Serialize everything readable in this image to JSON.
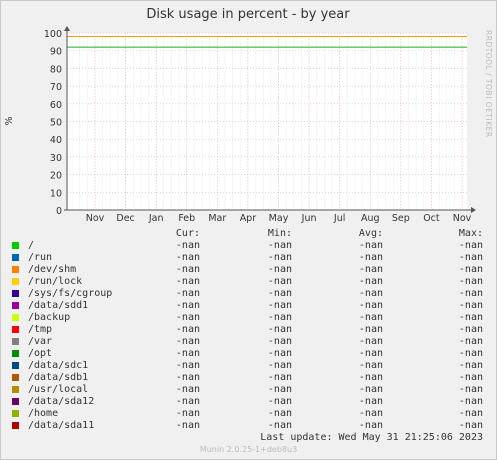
{
  "chart_data": {
    "type": "line",
    "title": "Disk usage in percent - by year",
    "ylabel": "%",
    "watermark": "RRDTOOL / TOBI OETIKER",
    "ylim": [
      0,
      100
    ],
    "yticks": [
      0,
      10,
      20,
      30,
      40,
      50,
      60,
      70,
      80,
      90,
      100
    ],
    "x_tick_labels": [
      "Nov",
      "Dec",
      "Jan",
      "Feb",
      "Mar",
      "Apr",
      "May",
      "Jun",
      "Jul",
      "Aug",
      "Sep",
      "Oct",
      "Nov"
    ],
    "grid": true,
    "threshold_lines": [
      {
        "value": 92,
        "color": "#22aa22"
      },
      {
        "value": 98,
        "color": "#ff9900"
      }
    ],
    "legend_headers": [
      "Cur:",
      "Min:",
      "Avg:",
      "Max:"
    ],
    "series": [
      {
        "name": "/",
        "color": "#00cc00",
        "cur": "-nan",
        "min": "-nan",
        "avg": "-nan",
        "max": "-nan"
      },
      {
        "name": "/run",
        "color": "#0066b3",
        "cur": "-nan",
        "min": "-nan",
        "avg": "-nan",
        "max": "-nan"
      },
      {
        "name": "/dev/shm",
        "color": "#ff8000",
        "cur": "-nan",
        "min": "-nan",
        "avg": "-nan",
        "max": "-nan"
      },
      {
        "name": "/run/lock",
        "color": "#ffcc00",
        "cur": "-nan",
        "min": "-nan",
        "avg": "-nan",
        "max": "-nan"
      },
      {
        "name": "/sys/fs/cgroup",
        "color": "#330099",
        "cur": "-nan",
        "min": "-nan",
        "avg": "-nan",
        "max": "-nan"
      },
      {
        "name": "/data/sdd1",
        "color": "#990099",
        "cur": "-nan",
        "min": "-nan",
        "avg": "-nan",
        "max": "-nan"
      },
      {
        "name": "/backup",
        "color": "#ccff00",
        "cur": "-nan",
        "min": "-nan",
        "avg": "-nan",
        "max": "-nan"
      },
      {
        "name": "/tmp",
        "color": "#ff0000",
        "cur": "-nan",
        "min": "-nan",
        "avg": "-nan",
        "max": "-nan"
      },
      {
        "name": "/var",
        "color": "#808080",
        "cur": "-nan",
        "min": "-nan",
        "avg": "-nan",
        "max": "-nan"
      },
      {
        "name": "/opt",
        "color": "#008f00",
        "cur": "-nan",
        "min": "-nan",
        "avg": "-nan",
        "max": "-nan"
      },
      {
        "name": "/data/sdc1",
        "color": "#00487d",
        "cur": "-nan",
        "min": "-nan",
        "avg": "-nan",
        "max": "-nan"
      },
      {
        "name": "/data/sdb1",
        "color": "#b35a00",
        "cur": "-nan",
        "min": "-nan",
        "avg": "-nan",
        "max": "-nan"
      },
      {
        "name": "/usr/local",
        "color": "#b38f00",
        "cur": "-nan",
        "min": "-nan",
        "avg": "-nan",
        "max": "-nan"
      },
      {
        "name": "/data/sda12",
        "color": "#6b006b",
        "cur": "-nan",
        "min": "-nan",
        "avg": "-nan",
        "max": "-nan"
      },
      {
        "name": "/home",
        "color": "#8fb300",
        "cur": "-nan",
        "min": "-nan",
        "avg": "-nan",
        "max": "-nan"
      },
      {
        "name": "/data/sda11",
        "color": "#b30000",
        "cur": "-nan",
        "min": "-nan",
        "avg": "-nan",
        "max": "-nan"
      }
    ]
  },
  "last_update": "Last update: Wed May 31 21:25:06 2023",
  "footer": "Munin 2.0.25-1+deb8u3"
}
